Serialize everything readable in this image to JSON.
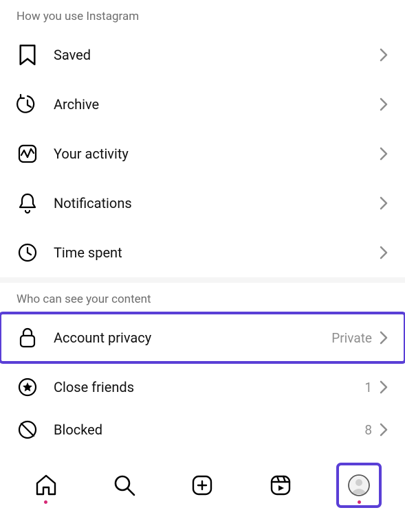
{
  "sections": {
    "usage": {
      "header": "How you use Instagram",
      "items": [
        {
          "label": "Saved"
        },
        {
          "label": "Archive"
        },
        {
          "label": "Your activity"
        },
        {
          "label": "Notifications"
        },
        {
          "label": "Time spent"
        }
      ]
    },
    "visibility": {
      "header": "Who can see your content",
      "items": [
        {
          "label": "Account privacy",
          "value": "Private"
        },
        {
          "label": "Close friends",
          "value": "1"
        },
        {
          "label": "Blocked",
          "value": "8"
        }
      ]
    }
  }
}
